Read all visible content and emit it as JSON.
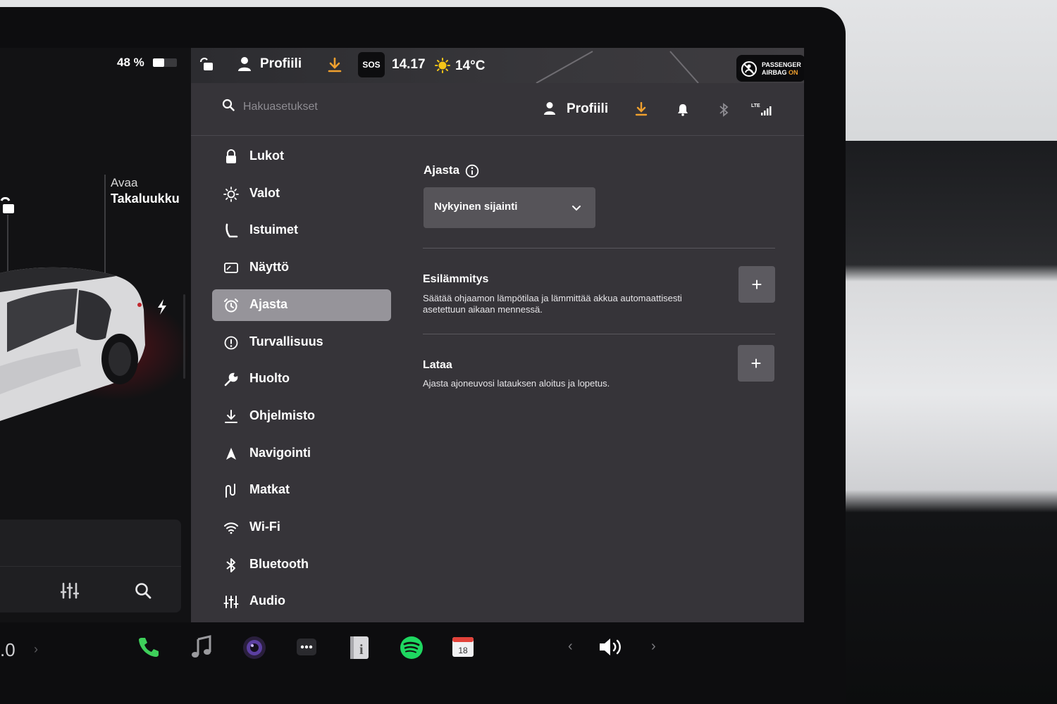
{
  "status": {
    "battery_percent_label": "48 %",
    "battery_level": 0.48
  },
  "car_panel": {
    "trunk_action": "Avaa",
    "trunk_label": "Takaluukku"
  },
  "topbar": {
    "profile_label": "Profiili",
    "sos_label": "SOS",
    "time": "14.17",
    "temperature": "14°C",
    "airbag_line1": "PASSENGER",
    "airbag_line2_prefix": "AIRBAG ",
    "airbag_state": "ON"
  },
  "settings_header": {
    "search_placeholder": "Hakuasetukset",
    "profile_label": "Profiili",
    "lte_label": "LTE"
  },
  "nav": {
    "items": [
      {
        "label": "Lukot",
        "icon": "lock-icon"
      },
      {
        "label": "Valot",
        "icon": "light-icon"
      },
      {
        "label": "Istuimet",
        "icon": "seat-icon"
      },
      {
        "label": "Näyttö",
        "icon": "display-icon"
      },
      {
        "label": "Ajasta",
        "icon": "alarm-clock-icon",
        "active": true
      },
      {
        "label": "Turvallisuus",
        "icon": "safety-icon"
      },
      {
        "label": "Huolto",
        "icon": "wrench-icon"
      },
      {
        "label": "Ohjelmisto",
        "icon": "download-icon"
      },
      {
        "label": "Navigointi",
        "icon": "navigation-icon"
      },
      {
        "label": "Matkat",
        "icon": "trips-icon"
      },
      {
        "label": "Wi-Fi",
        "icon": "wifi-icon"
      },
      {
        "label": "Bluetooth",
        "icon": "bluetooth-icon"
      },
      {
        "label": "Audio",
        "icon": "equalizer-icon"
      }
    ]
  },
  "schedule": {
    "title": "Ajasta",
    "location_dropdown": "Nykyinen sijainti",
    "sections": [
      {
        "title": "Esilämmitys",
        "description": "Säätää ohjaamon lämpötilaa ja lämmittää akkua automaattisesti asetettuun aikaan mennessä.",
        "button": "+"
      },
      {
        "title": "Lataa",
        "description": "Ajasta ajoneuvosi latauksen aloitus ja lopetus.",
        "button": "+"
      }
    ]
  },
  "dock": {
    "left_text": ".0",
    "calendar_day": "18",
    "apps": [
      "phone-icon",
      "music-icon",
      "camera-icon",
      "more-icon",
      "manual-icon",
      "spotify-icon",
      "calendar-icon"
    ]
  },
  "colors": {
    "accent_orange": "#f0a02e",
    "active_nav": "#96949a",
    "screen_bg": "#363439",
    "phone_green": "#3ecf5a",
    "spotify_green": "#1ed760"
  }
}
